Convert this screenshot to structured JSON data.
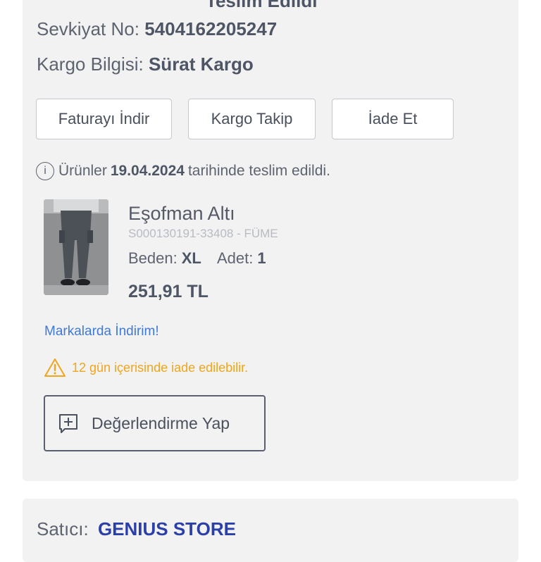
{
  "order": {
    "status_row_clipped": "Teslim Edildi",
    "shipment_label": "Sevkiyat No:",
    "shipment_number": "5404162205247",
    "cargo_label": "Kargo Bilgisi:",
    "cargo_company": "Sürat Kargo"
  },
  "actions": {
    "invoice_label": "Faturayı İndir",
    "track_label": "Kargo Takip",
    "return_label": "İade Et"
  },
  "delivery": {
    "prefix": "Ürünler",
    "date": "19.04.2024",
    "suffix": "tarihinde teslim edildi.",
    "icon": "info-icon"
  },
  "product": {
    "name": "Eşofman Altı",
    "sku": "S000130191-33408 - FÜME",
    "size_label": "Beden:",
    "size_value": "XL",
    "qty_label": "Adet:",
    "qty_value": "1",
    "price": "251,91 TL"
  },
  "promo": {
    "link_text": "Markalarda İndirim!"
  },
  "return_notice": {
    "text": "12 gün içerisinde iade edilebilir.",
    "icon": "warning-icon",
    "color": "#efa51c"
  },
  "review": {
    "label": "Değerlendirme Yap",
    "icon": "add-review-icon"
  },
  "seller": {
    "label": "Satıcı:",
    "store": "GENIUS STORE",
    "store_color": "#2b3fa8"
  }
}
